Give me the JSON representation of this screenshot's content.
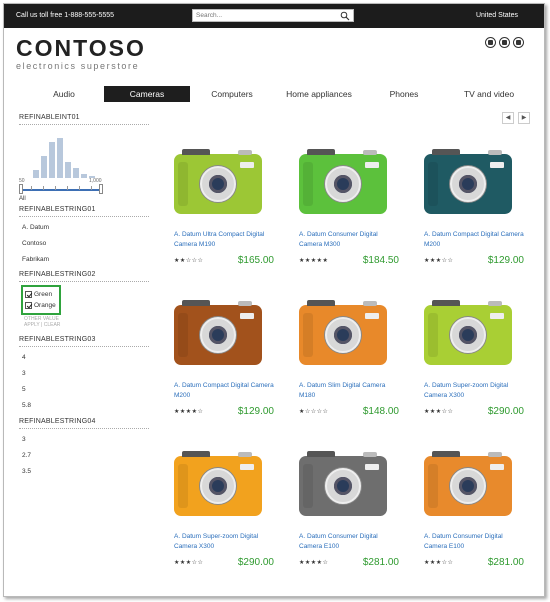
{
  "topbar": {
    "toll_free": "Call us toll free 1-888-555-5555",
    "search_placeholder": "Search...",
    "country": "United States"
  },
  "logo": {
    "name": "CONTOSO",
    "tagline": "electronics superstore"
  },
  "header_icons": [
    "help-icon",
    "cart-icon",
    "question-icon"
  ],
  "nav": {
    "tabs": [
      "Audio",
      "Cameras",
      "Computers",
      "Home appliances",
      "Phones",
      "TV and video"
    ],
    "active": "Cameras"
  },
  "sidebar": {
    "int_refiner": {
      "title": "REFINABLEINT01",
      "histogram": [
        0.2,
        0.55,
        0.9,
        1.0,
        0.4,
        0.25,
        0.1,
        0.05
      ],
      "min_label": "50",
      "max_label": "1,000",
      "all_label": "All"
    },
    "string01": {
      "title": "REFINABLESTRING01",
      "options": [
        "A. Datum",
        "Contoso",
        "Fabrikam"
      ]
    },
    "string02": {
      "title": "REFINABLESTRING02",
      "options": [
        "Green",
        "Orange"
      ],
      "other_value": "OTHER VALUE",
      "apply": "APPLY",
      "clear": "CLEAR"
    },
    "string03": {
      "title": "REFINABLESTRING03",
      "options": [
        "4",
        "3",
        "5",
        "5.8"
      ]
    },
    "string04": {
      "title": "REFINABLESTRING04",
      "options": [
        "3",
        "2.7",
        "3.5"
      ]
    }
  },
  "pager": {
    "prev": "◀",
    "next": "▶"
  },
  "products": [
    {
      "name": "A. Datum Ultra Compact Digital Camera M190",
      "stars": "★★☆☆☆",
      "price": "$165.00",
      "color": "#9cc735"
    },
    {
      "name": "A. Datum Consumer Digital Camera M300",
      "stars": "★★★★★",
      "price": "$184.50",
      "color": "#5cc13c"
    },
    {
      "name": "A. Datum Compact Digital Camera M200",
      "stars": "★★★☆☆",
      "price": "$129.00",
      "color": "#1f5a63"
    },
    {
      "name": "A. Datum Compact Digital Camera M200",
      "stars": "★★★★☆",
      "price": "$129.00",
      "color": "#a2521c"
    },
    {
      "name": "A. Datum Slim Digital Camera M180",
      "stars": "★☆☆☆☆",
      "price": "$148.00",
      "color": "#e8892a"
    },
    {
      "name": "A. Datum Super-zoom Digital Camera X300",
      "stars": "★★★☆☆",
      "price": "$290.00",
      "color": "#a9cf34"
    },
    {
      "name": "A. Datum Super-zoom Digital Camera X300",
      "stars": "★★★☆☆",
      "price": "$290.00",
      "color": "#f2a21e"
    },
    {
      "name": "A. Datum Consumer Digital Camera E100",
      "stars": "★★★★☆",
      "price": "$281.00",
      "color": "#6e6e6e"
    },
    {
      "name": "A. Datum Consumer Digital Camera E100",
      "stars": "★★★☆☆",
      "price": "$281.00",
      "color": "#e88a2c"
    }
  ]
}
